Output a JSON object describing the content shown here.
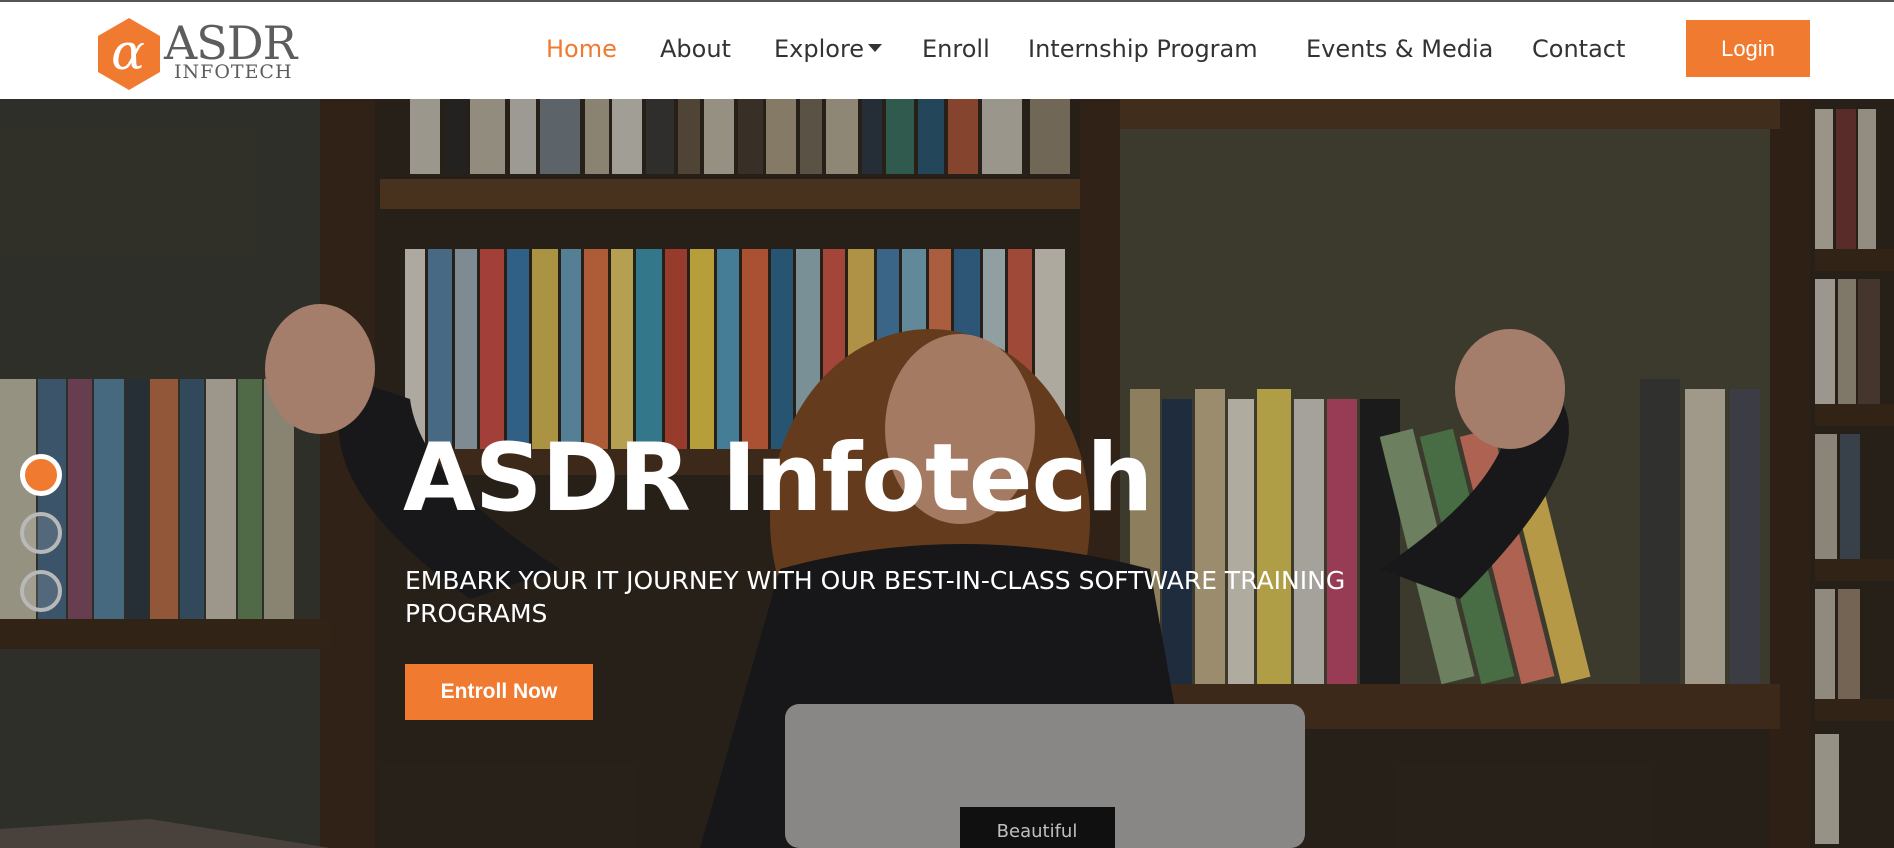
{
  "brand": {
    "logo_glyph": "α",
    "logo_word": "ASDR",
    "logo_sub": "INFOTECH",
    "hex_color": "#f07a2f"
  },
  "nav": {
    "items": [
      {
        "label": "Home",
        "active": true
      },
      {
        "label": "About"
      },
      {
        "label": "Explore",
        "dropdown": true
      },
      {
        "label": "Enroll"
      },
      {
        "label": "Internship Program"
      },
      {
        "label": "Events & Media"
      },
      {
        "label": "Contact"
      }
    ],
    "login_label": "Login"
  },
  "hero": {
    "title": "ASDR Infotech",
    "subtitle": "EMBARK YOUR IT JOURNEY WITH OUR BEST-IN-CLASS SOFTWARE TRAINING PROGRAMS",
    "cta_label": "Entroll Now",
    "laptop_sticker": "Beautiful"
  },
  "carousel": {
    "slides": 3,
    "active_index": 0
  },
  "colors": {
    "accent": "#f07a2f",
    "text": "#333333"
  }
}
